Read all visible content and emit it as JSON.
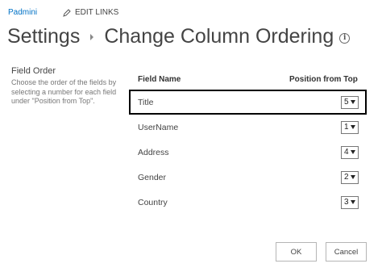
{
  "header": {
    "site_name": "Padmini",
    "edit_links": "EDIT LINKS",
    "breadcrumb_root": "Settings",
    "page_title": "Change Column Ordering",
    "info_icon": "info-icon"
  },
  "section": {
    "title": "Field Order",
    "description": "Choose the order of the fields by selecting a number for each field under \"Position from Top\"."
  },
  "table": {
    "columns": [
      "Field Name",
      "Position from Top"
    ],
    "rows": [
      {
        "name": "Title",
        "position": "5"
      },
      {
        "name": "UserName",
        "position": "1"
      },
      {
        "name": "Address",
        "position": "4"
      },
      {
        "name": "Gender",
        "position": "2"
      },
      {
        "name": "Country",
        "position": "3"
      }
    ]
  },
  "buttons": {
    "ok": "OK",
    "cancel": "Cancel"
  }
}
